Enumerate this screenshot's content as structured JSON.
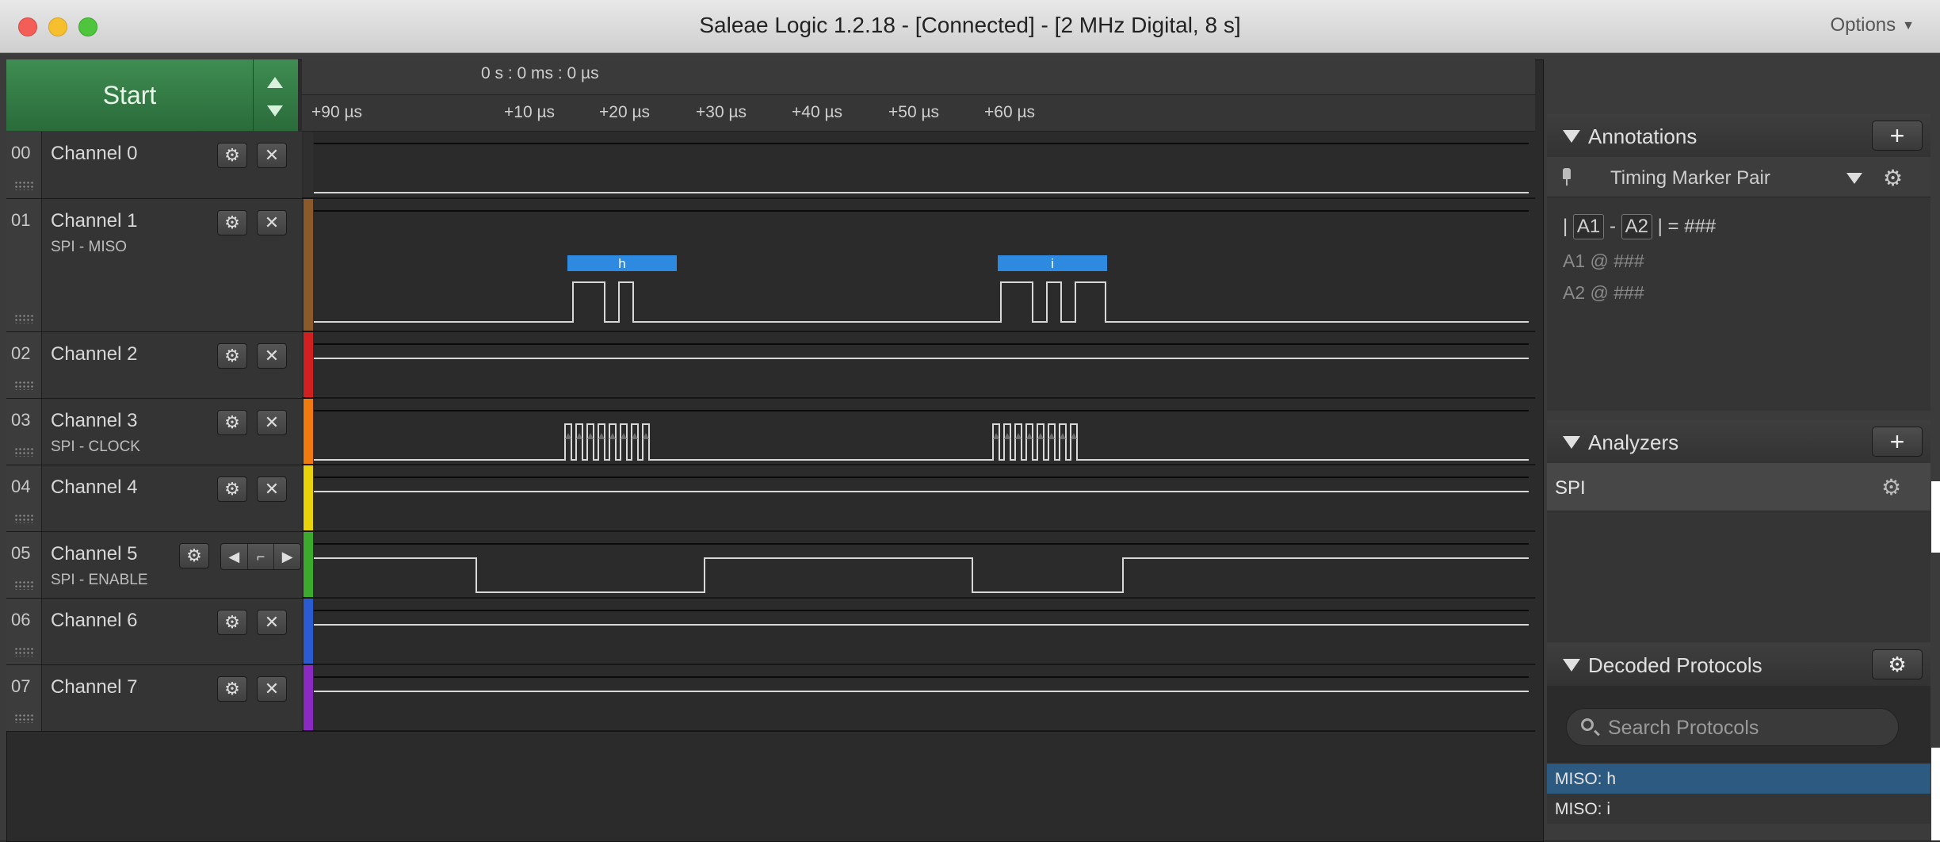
{
  "window": {
    "title": "Saleae Logic 1.2.18 - [Connected] - [2 MHz Digital, 8 s]",
    "options_label": "Options"
  },
  "capture": {
    "start_label": "Start"
  },
  "timeline": {
    "cursor_time": "0 s : 0 ms : 0 µs",
    "ticks": [
      "+90 µs",
      "+10 µs",
      "+20 µs",
      "+30 µs",
      "+40 µs",
      "+50 µs",
      "+60 µs"
    ]
  },
  "channels": [
    {
      "num": "00",
      "name": "Channel 0",
      "sub": "",
      "color": "#2f2f2f"
    },
    {
      "num": "01",
      "name": "Channel 1",
      "sub": "SPI - MISO",
      "color": "#8a5a2b"
    },
    {
      "num": "02",
      "name": "Channel 2",
      "sub": "",
      "color": "#d02020"
    },
    {
      "num": "03",
      "name": "Channel 3",
      "sub": "SPI - CLOCK",
      "color": "#ef7a10"
    },
    {
      "num": "04",
      "name": "Channel 4",
      "sub": "",
      "color": "#e8d20a"
    },
    {
      "num": "05",
      "name": "Channel 5",
      "sub": "SPI - ENABLE",
      "color": "#3caa2c"
    },
    {
      "num": "06",
      "name": "Channel 6",
      "sub": "",
      "color": "#2a5bd0"
    },
    {
      "num": "07",
      "name": "Channel 7",
      "sub": "",
      "color": "#8a2ac0"
    }
  ],
  "decoded_bubbles": [
    "h",
    "i"
  ],
  "annotations": {
    "title": "Annotations",
    "marker_name": "Timing Marker Pair",
    "formula": {
      "bar": "|",
      "a1": "A1",
      "minus": "-",
      "a2": "A2",
      "equals": "| = ###"
    },
    "a1_line": "A1  @  ###",
    "a2_line": "A2  @  ###"
  },
  "analyzers": {
    "title": "Analyzers",
    "items": [
      "SPI"
    ]
  },
  "decoded_protocols": {
    "title": "Decoded Protocols",
    "search_placeholder": "Search Protocols",
    "rows": [
      "MISO: h",
      "MISO: i"
    ]
  },
  "colors": {
    "accent_green": "#2f7a43",
    "selection_blue": "#2d5a80",
    "decode_blue": "#2d8ae0"
  }
}
